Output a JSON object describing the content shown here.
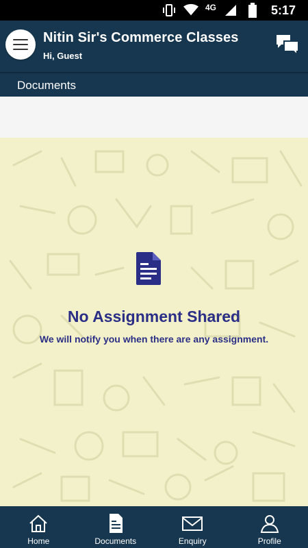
{
  "status_bar": {
    "time": "5:17",
    "network": "4G",
    "icons": [
      "vibrate-icon",
      "wifi-icon",
      "signal-icon",
      "battery-icon"
    ]
  },
  "app_bar": {
    "title": "Nitin Sir's Commerce Classes",
    "subtitle": "Hi, Guest",
    "menu_icon": "hamburger-menu-icon",
    "chat_icon": "chat-bubbles-icon"
  },
  "section": {
    "title": "Documents"
  },
  "empty_state": {
    "icon": "document-icon",
    "title": "No Assignment Shared",
    "message": "We will notify you when there are any assignment."
  },
  "bottom_nav": {
    "items": [
      {
        "label": "Home",
        "icon": "home-icon"
      },
      {
        "label": "Documents",
        "icon": "document-icon"
      },
      {
        "label": "Enquiry",
        "icon": "envelope-icon"
      },
      {
        "label": "Profile",
        "icon": "profile-icon"
      }
    ]
  },
  "colors": {
    "primary": "#16374f",
    "background": "#f2f1c9",
    "accent_text": "#2b2e86"
  }
}
